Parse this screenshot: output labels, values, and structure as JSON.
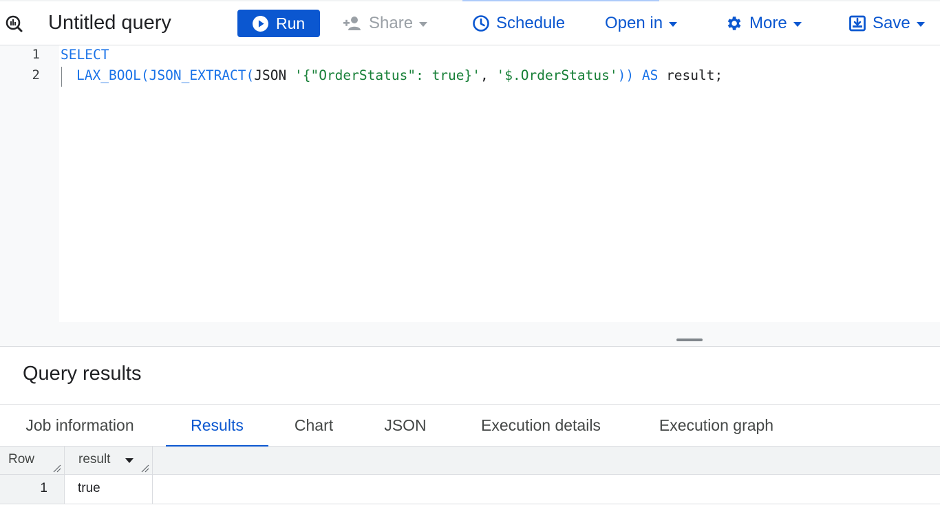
{
  "toolbar": {
    "title": "Untitled query",
    "run_label": "Run",
    "share_label": "Share",
    "schedule_label": "Schedule",
    "open_in_label": "Open in",
    "more_label": "More",
    "save_label": "Save",
    "icons": {
      "query": "query-icon",
      "run": "play-circle-icon",
      "share": "person-add-icon",
      "schedule": "clock-icon",
      "more": "gear-icon",
      "save": "save-icon"
    },
    "accent_color": "#0b57d0"
  },
  "editor": {
    "line_numbers": [
      "1",
      "2"
    ],
    "line1": {
      "kw": "SELECT"
    },
    "line2": {
      "fn": "LAX_BOOL(JSON_EXTRACT(",
      "plain1": "JSON ",
      "str1": "'{\"OrderStatus\": true}'",
      "sep": ", ",
      "str2": "'$.OrderStatus'",
      "close": "))",
      "sp": " ",
      "kw": "AS",
      "plain2": " result;"
    }
  },
  "results": {
    "title": "Query results",
    "tabs": [
      {
        "label": "Job information",
        "active": false
      },
      {
        "label": "Results",
        "active": true
      },
      {
        "label": "Chart",
        "active": false
      },
      {
        "label": "JSON",
        "active": false
      },
      {
        "label": "Execution details",
        "active": false
      },
      {
        "label": "Execution graph",
        "active": false
      }
    ],
    "columns": [
      "Row",
      "result"
    ],
    "rows": [
      {
        "row": "1",
        "result": "true"
      }
    ]
  }
}
